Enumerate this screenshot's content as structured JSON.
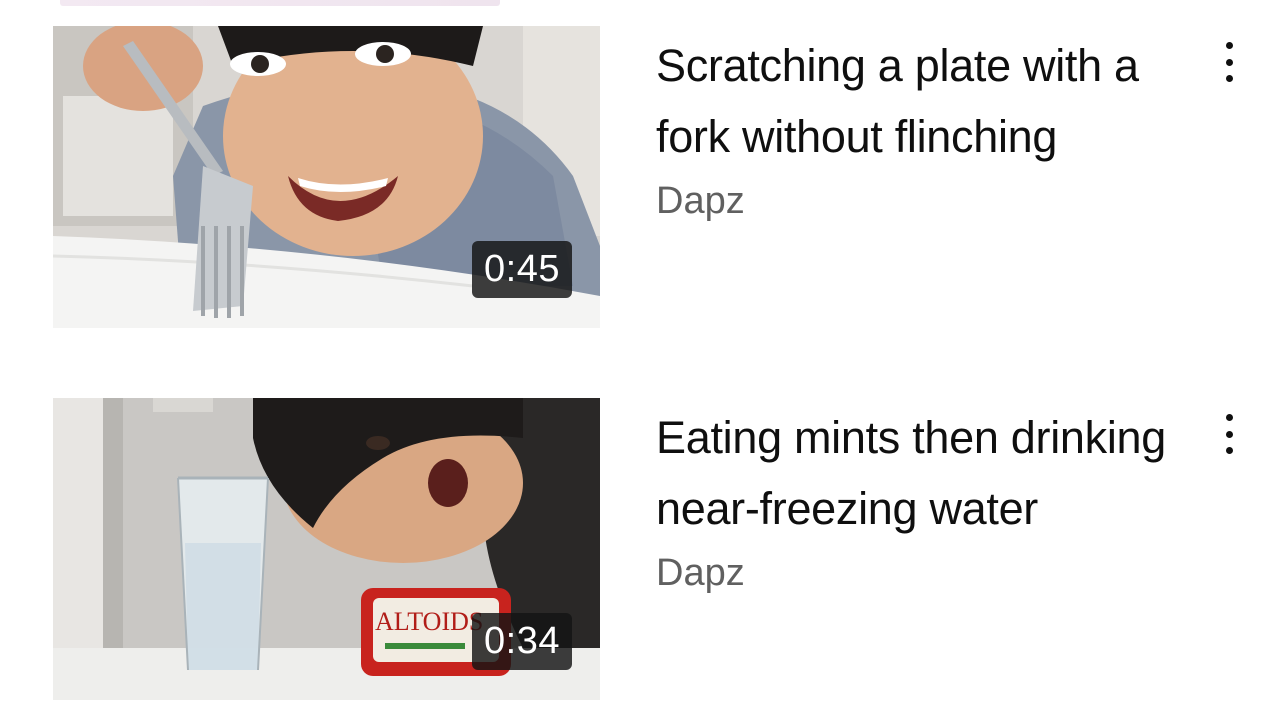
{
  "videos": [
    {
      "title": "Scratching a plate with a fork without flinching",
      "channel": "Dapz",
      "duration": "0:45",
      "more_icon": "vertical-ellipsis-icon"
    },
    {
      "title": "Eating mints then drinking near-freezing water",
      "channel": "Dapz",
      "duration": "0:34",
      "more_icon": "vertical-ellipsis-icon",
      "thumbnail_label": "ALTOIDS"
    }
  ]
}
